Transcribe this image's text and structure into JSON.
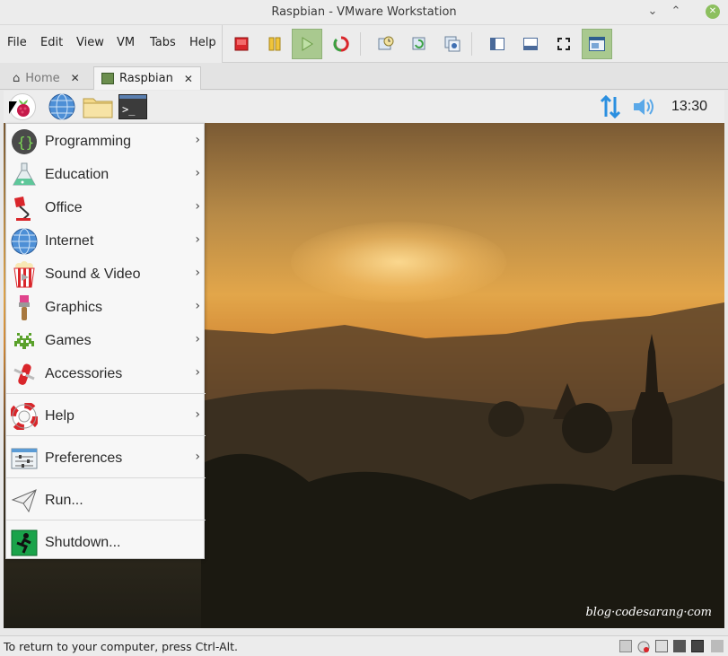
{
  "window": {
    "title": "Raspbian - VMware Workstation"
  },
  "menubar": {
    "items": [
      "File",
      "Edit",
      "View",
      "VM",
      "Tabs",
      "Help"
    ]
  },
  "toolbar": {
    "icons": [
      "power-off-icon",
      "pause-icon",
      "play-icon",
      "restart-icon",
      "snapshot-icon",
      "revert-snapshot-icon",
      "snapshot-manager-icon",
      "sidebar-toggle-icon",
      "thumbnail-bar-icon",
      "fullscreen-icon",
      "unity-icon"
    ]
  },
  "tabs": [
    {
      "label": "Home",
      "selected": false
    },
    {
      "label": "Raspbian",
      "selected": true
    }
  ],
  "panel": {
    "clock": "13:30"
  },
  "start_menu": {
    "items": [
      {
        "label": "Programming",
        "icon": "programming-icon",
        "submenu": true
      },
      {
        "label": "Education",
        "icon": "education-flask-icon",
        "submenu": true
      },
      {
        "label": "Office",
        "icon": "office-lamp-icon",
        "submenu": true
      },
      {
        "label": "Internet",
        "icon": "globe-icon",
        "submenu": true
      },
      {
        "label": "Sound & Video",
        "icon": "popcorn-icon",
        "submenu": true
      },
      {
        "label": "Graphics",
        "icon": "paintbrush-icon",
        "submenu": true
      },
      {
        "label": "Games",
        "icon": "space-invader-icon",
        "submenu": true
      },
      {
        "label": "Accessories",
        "icon": "pocket-knife-icon",
        "submenu": true
      },
      {
        "label": "Help",
        "icon": "lifebuoy-icon",
        "submenu": true
      },
      {
        "label": "Preferences",
        "icon": "preferences-icon",
        "submenu": true
      },
      {
        "label": "Run...",
        "icon": "paper-plane-icon",
        "submenu": false
      },
      {
        "label": "Shutdown...",
        "icon": "exit-icon",
        "submenu": false
      }
    ]
  },
  "watermark": "blog·codesarang·com",
  "statusbar": {
    "text": "To return to your computer, press Ctrl-Alt."
  },
  "colors": {
    "accent_green": "#8cbf5e",
    "toolbar_active": "#a9c98f",
    "raspberry": "#c51a4a"
  }
}
